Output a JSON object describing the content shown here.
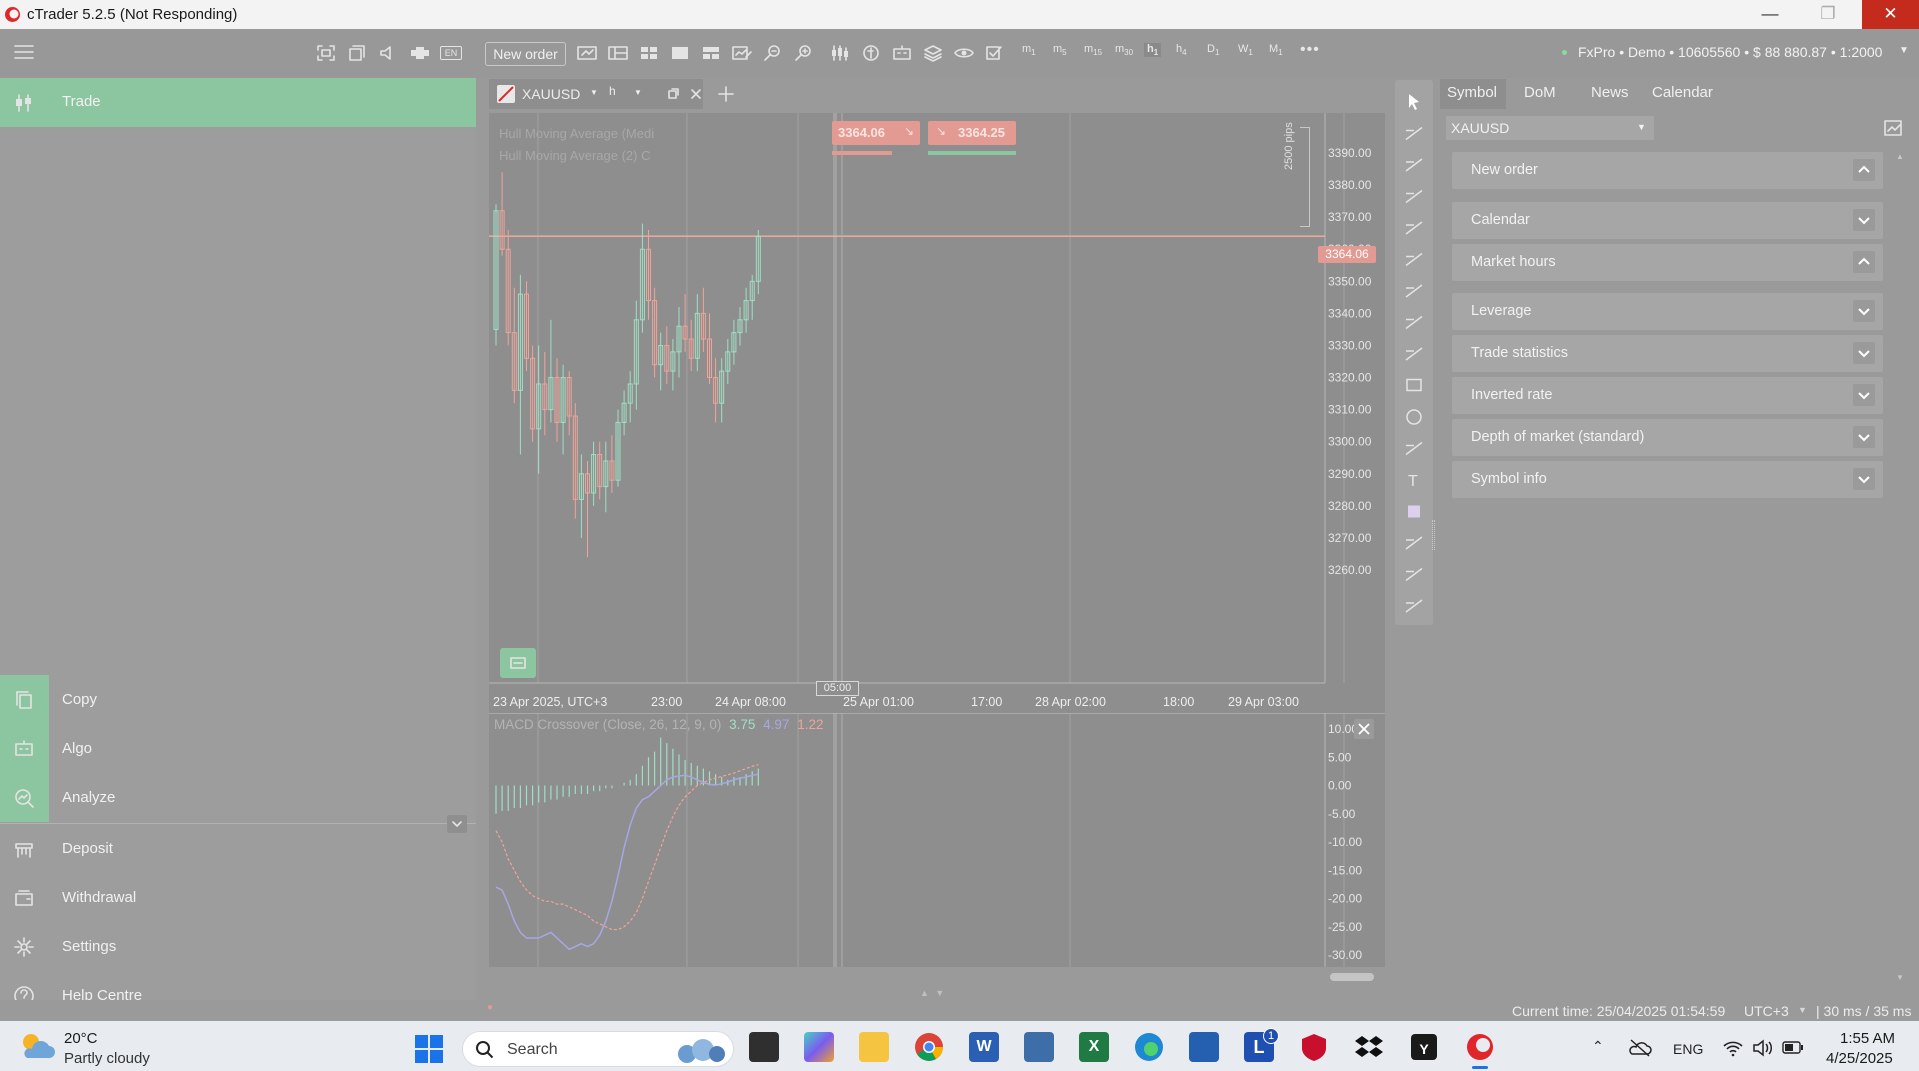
{
  "window": {
    "title": "cTrader 5.2.5 (Not Responding)"
  },
  "toolbar": {
    "new_order_label": "New order",
    "timeframes": [
      {
        "base": "m",
        "sub": "1"
      },
      {
        "base": "m",
        "sub": "5"
      },
      {
        "base": "m",
        "sub": "15"
      },
      {
        "base": "m",
        "sub": "30"
      },
      {
        "base": "h",
        "sub": "1"
      },
      {
        "base": "h",
        "sub": "4"
      },
      {
        "base": "D",
        "sub": "1"
      },
      {
        "base": "W",
        "sub": "1"
      },
      {
        "base": "M",
        "sub": "1"
      }
    ],
    "language_badge": "EN",
    "account_info": "FxPro • Demo • 10605560 • $ 88 880.87 • 1:2000"
  },
  "sidebar": {
    "top_item": "Trade",
    "items": [
      "Copy",
      "Algo",
      "Analyze",
      "Deposit",
      "Withdrawal",
      "Settings",
      "Help Centre"
    ]
  },
  "chart": {
    "tab_symbol": "XAUUSD",
    "tab_timeframe": "h",
    "indicator_labels": [
      "Hull Moving Average (Medi",
      "Hull Moving Average (2) C"
    ],
    "sell_price": "3364.06",
    "buy_price": "3364.25",
    "current_price_tag": "3364.06",
    "pips_label": "2500 pips",
    "crosshair_time": "05:00",
    "y_ticks": [
      "3390.00",
      "3380.00",
      "3370.00",
      "3360.00",
      "3350.00",
      "3340.00",
      "3330.00",
      "3320.00",
      "3310.00",
      "3300.00",
      "3290.00",
      "3280.00",
      "3270.00",
      "3260.00"
    ],
    "x_ticks": [
      "23 Apr 2025, UTC+3",
      "23:00",
      "24 Apr 08:00",
      "25 Apr 01:00",
      "17:00",
      "28 Apr 02:00",
      "18:00",
      "29 Apr 03:00"
    ],
    "macd": {
      "title": "MACD Crossover (Close, 26, 12, 9, 0)",
      "values": [
        "3.75",
        "4.97",
        "1.22"
      ],
      "value_colors": [
        "#9fe0c4",
        "#a7a7e4",
        "#f0a49a"
      ],
      "y_ticks": [
        "10.00",
        "5.00",
        "0.00",
        "-5.00",
        "-10.00",
        "-15.00",
        "-20.00",
        "-25.00",
        "-30.00"
      ]
    }
  },
  "right_panel": {
    "tabs": [
      "Symbol",
      "DoM",
      "News",
      "Calendar"
    ],
    "symbol_select": "XAUUSD",
    "sections": [
      {
        "label": "New order",
        "expanded": true
      },
      {
        "label": "Calendar",
        "expanded": false
      },
      {
        "label": "Market hours",
        "expanded": true
      },
      {
        "label": "Leverage",
        "expanded": false
      },
      {
        "label": "Trade statistics",
        "expanded": false
      },
      {
        "label": "Inverted rate",
        "expanded": false
      },
      {
        "label": "Depth of market (standard)",
        "expanded": false
      },
      {
        "label": "Symbol info",
        "expanded": false
      }
    ]
  },
  "status_bar": {
    "current_time": "Current time: 25/04/2025 01:54:59",
    "timezone": "UTC+3",
    "latency": "| 30 ms / 35 ms"
  },
  "taskbar": {
    "weather_temp": "20°C",
    "weather_desc": "Partly cloudy",
    "search_label": "Search",
    "notification_badge": "1",
    "language": "ENG",
    "time": "1:55 AM",
    "date": "4/25/2025"
  },
  "candles": [
    [
      3335,
      3374,
      3330,
      3372
    ],
    [
      3372,
      3384,
      3358,
      3360
    ],
    [
      3360,
      3366,
      3330,
      3334
    ],
    [
      3334,
      3348,
      3312,
      3316
    ],
    [
      3316,
      3352,
      3296,
      3346
    ],
    [
      3346,
      3350,
      3322,
      3326
    ],
    [
      3326,
      3330,
      3300,
      3304
    ],
    [
      3304,
      3330,
      3290,
      3318
    ],
    [
      3318,
      3328,
      3302,
      3310
    ],
    [
      3310,
      3338,
      3306,
      3320
    ],
    [
      3320,
      3326,
      3300,
      3306
    ],
    [
      3306,
      3324,
      3296,
      3320
    ],
    [
      3320,
      3322,
      3302,
      3308
    ],
    [
      3308,
      3312,
      3276,
      3282
    ],
    [
      3282,
      3296,
      3270,
      3290
    ],
    [
      3290,
      3294,
      3264,
      3284
    ],
    [
      3284,
      3300,
      3280,
      3296
    ],
    [
      3296,
      3300,
      3282,
      3286
    ],
    [
      3286,
      3300,
      3278,
      3294
    ],
    [
      3294,
      3302,
      3284,
      3288
    ],
    [
      3288,
      3310,
      3286,
      3306
    ],
    [
      3306,
      3316,
      3302,
      3312
    ],
    [
      3312,
      3322,
      3306,
      3318
    ],
    [
      3318,
      3344,
      3310,
      3338
    ],
    [
      3338,
      3368,
      3334,
      3360
    ],
    [
      3360,
      3366,
      3338,
      3344
    ],
    [
      3344,
      3348,
      3320,
      3324
    ],
    [
      3324,
      3334,
      3316,
      3330
    ],
    [
      3330,
      3336,
      3318,
      3322
    ],
    [
      3322,
      3332,
      3316,
      3328
    ],
    [
      3328,
      3342,
      3320,
      3336
    ],
    [
      3336,
      3346,
      3328,
      3332
    ],
    [
      3332,
      3338,
      3322,
      3326
    ],
    [
      3326,
      3346,
      3322,
      3340
    ],
    [
      3340,
      3348,
      3328,
      3332
    ],
    [
      3332,
      3340,
      3318,
      3320
    ],
    [
      3320,
      3326,
      3306,
      3312
    ],
    [
      3312,
      3326,
      3306,
      3322
    ],
    [
      3322,
      3332,
      3318,
      3328
    ],
    [
      3328,
      3338,
      3324,
      3334
    ],
    [
      3334,
      3342,
      3330,
      3338
    ],
    [
      3338,
      3348,
      3334,
      3344
    ],
    [
      3344,
      3352,
      3338,
      3350
    ],
    [
      3350,
      3366,
      3346,
      3364
    ]
  ]
}
